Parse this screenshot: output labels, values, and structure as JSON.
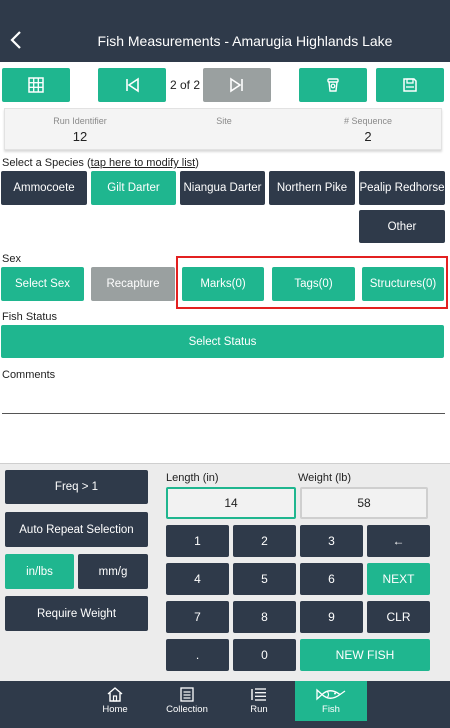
{
  "header": {
    "title": "Fish Measurements - Amarugia Highlands Lake"
  },
  "toolbar": {
    "pager_text": "2 of 2"
  },
  "run_info": {
    "run_identifier_label": "Run Identifier",
    "run_identifier_value": "12",
    "site_label": "Site",
    "sequence_label": "# Sequence",
    "sequence_value": "2"
  },
  "species": {
    "prompt": "Select a Species (",
    "link": "tap here to modify list",
    "prompt_end": ")",
    "buttons": [
      "Ammocoete",
      "Gilt Darter",
      "Niangua Darter",
      "Northern Pike",
      "Pealip Redhorse",
      "Other"
    ]
  },
  "sex": {
    "label": "Sex",
    "select_sex": "Select Sex",
    "recapture": "Recapture",
    "marks": "Marks(0)",
    "tags": "Tags(0)",
    "structures": "Structures(0)"
  },
  "fish_status": {
    "label": "Fish Status",
    "button": "Select Status"
  },
  "comments": {
    "label": "Comments"
  },
  "options": {
    "freq": "Freq > 1",
    "auto_repeat": "Auto Repeat Selection",
    "in_lbs": "in/lbs",
    "mm_g": "mm/g",
    "require_weight": "Require Weight"
  },
  "measure": {
    "length_label": "Length (in)",
    "length_value": "14",
    "weight_label": "Weight (lb)",
    "weight_value": "58"
  },
  "keypad": {
    "k1": "1",
    "k2": "2",
    "k3": "3",
    "back": "←",
    "k4": "4",
    "k5": "5",
    "k6": "6",
    "next": "NEXT",
    "k7": "7",
    "k8": "8",
    "k9": "9",
    "clr": "CLR",
    "dot": ".",
    "k0": "0",
    "new_fish": "NEW FISH"
  },
  "nav": {
    "home": "Home",
    "collection": "Collection",
    "run": "Run",
    "fish": "Fish"
  },
  "colors": {
    "teal": "#1fb68f",
    "dark": "#2f3a4a",
    "gray": "#9aa0a0",
    "highlight": "#e32020"
  }
}
